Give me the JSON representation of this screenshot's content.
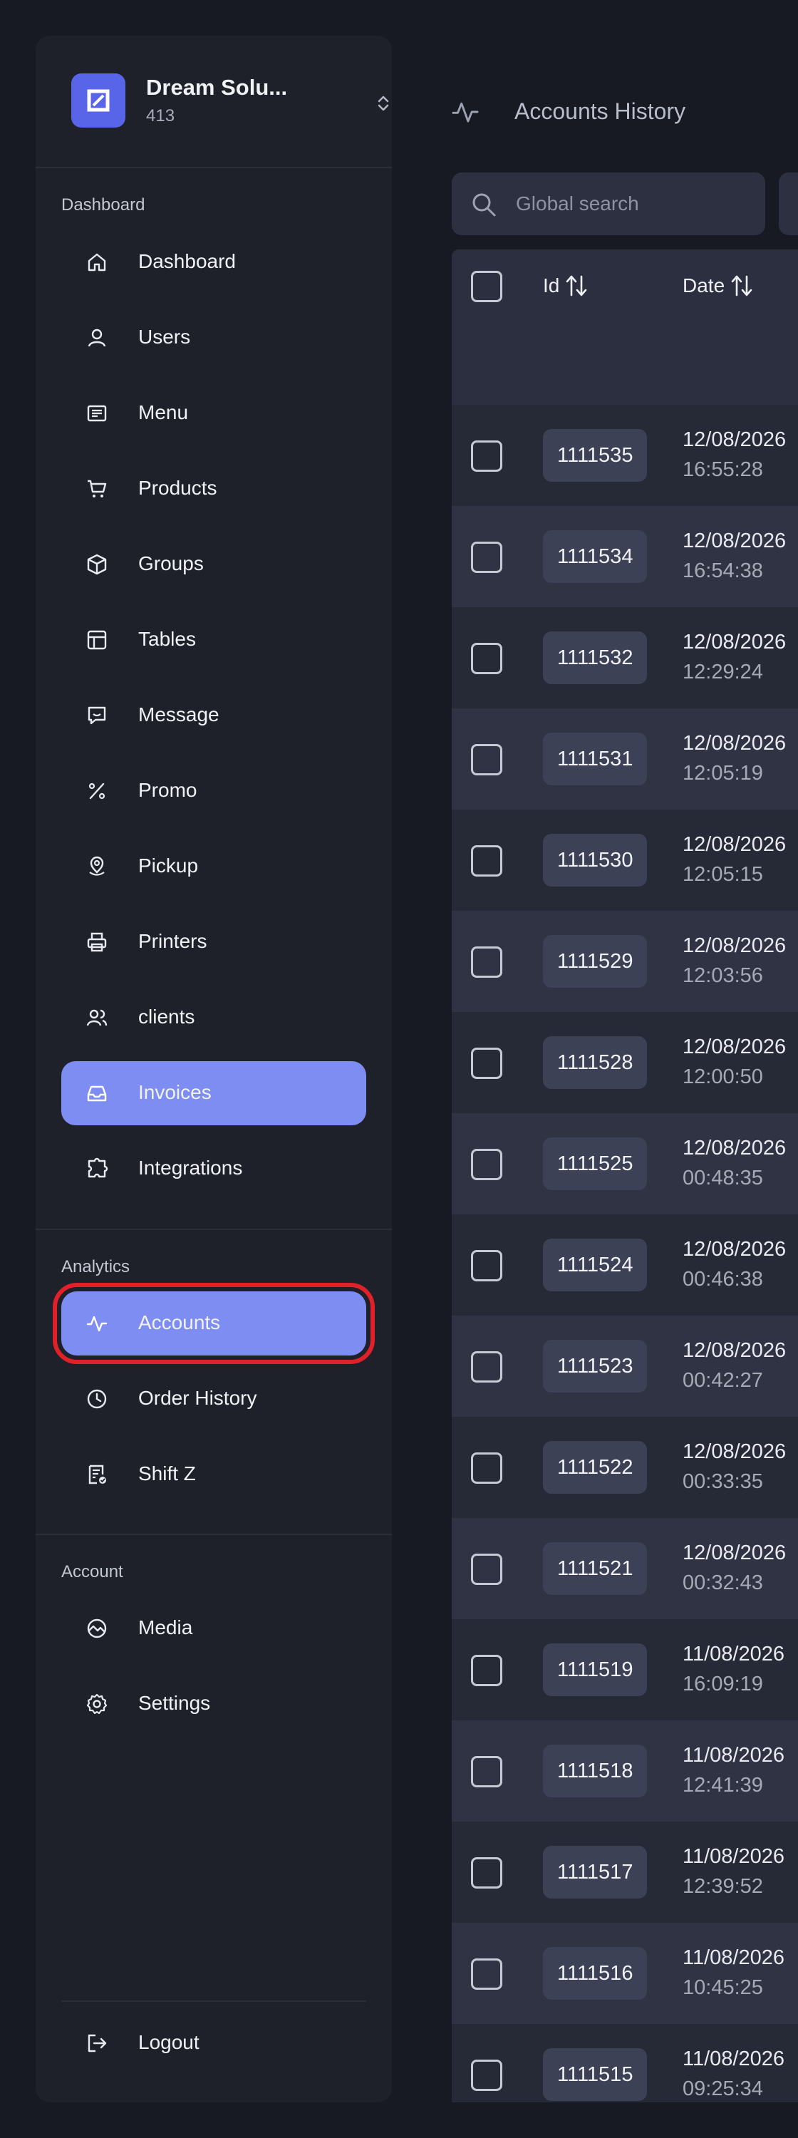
{
  "brand": {
    "name": "Dream Solu...",
    "subtitle": "413"
  },
  "sections": {
    "dashboard": "Dashboard",
    "analytics": "Analytics",
    "account": "Account"
  },
  "nav": {
    "dashboard": "Dashboard",
    "users": "Users",
    "menu": "Menu",
    "products": "Products",
    "groups": "Groups",
    "tables": "Tables",
    "message": "Message",
    "promo": "Promo",
    "pickup": "Pickup",
    "printers": "Printers",
    "clients": "clients",
    "invoices": "Invoices",
    "integrations": "Integrations",
    "accounts": "Accounts",
    "order_history": "Order History",
    "shift_z": "Shift Z",
    "media": "Media",
    "settings": "Settings",
    "logout": "Logout"
  },
  "header": {
    "title": "Accounts History"
  },
  "search": {
    "placeholder": "Global search"
  },
  "table": {
    "columns": {
      "id": "Id",
      "date": "Date"
    },
    "rows": [
      {
        "id": "1111535",
        "date": "12/08/2026",
        "time": "16:55:28"
      },
      {
        "id": "1111534",
        "date": "12/08/2026",
        "time": "16:54:38"
      },
      {
        "id": "1111532",
        "date": "12/08/2026",
        "time": "12:29:24"
      },
      {
        "id": "1111531",
        "date": "12/08/2026",
        "time": "12:05:19"
      },
      {
        "id": "1111530",
        "date": "12/08/2026",
        "time": "12:05:15"
      },
      {
        "id": "1111529",
        "date": "12/08/2026",
        "time": "12:03:56"
      },
      {
        "id": "1111528",
        "date": "12/08/2026",
        "time": "12:00:50"
      },
      {
        "id": "1111525",
        "date": "12/08/2026",
        "time": "00:48:35"
      },
      {
        "id": "1111524",
        "date": "12/08/2026",
        "time": "00:46:38"
      },
      {
        "id": "1111523",
        "date": "12/08/2026",
        "time": "00:42:27"
      },
      {
        "id": "1111522",
        "date": "12/08/2026",
        "time": "00:33:35"
      },
      {
        "id": "1111521",
        "date": "12/08/2026",
        "time": "00:32:43"
      },
      {
        "id": "1111519",
        "date": "11/08/2026",
        "time": "16:09:19"
      },
      {
        "id": "1111518",
        "date": "11/08/2026",
        "time": "12:41:39"
      },
      {
        "id": "1111517",
        "date": "11/08/2026",
        "time": "12:39:52"
      },
      {
        "id": "1111516",
        "date": "11/08/2026",
        "time": "10:45:25"
      },
      {
        "id": "1111515",
        "date": "11/08/2026",
        "time": "09:25:34"
      }
    ]
  },
  "colors": {
    "accent": "#7e8df1",
    "brand": "#5865e8",
    "highlight_ring": "#e0212a"
  }
}
